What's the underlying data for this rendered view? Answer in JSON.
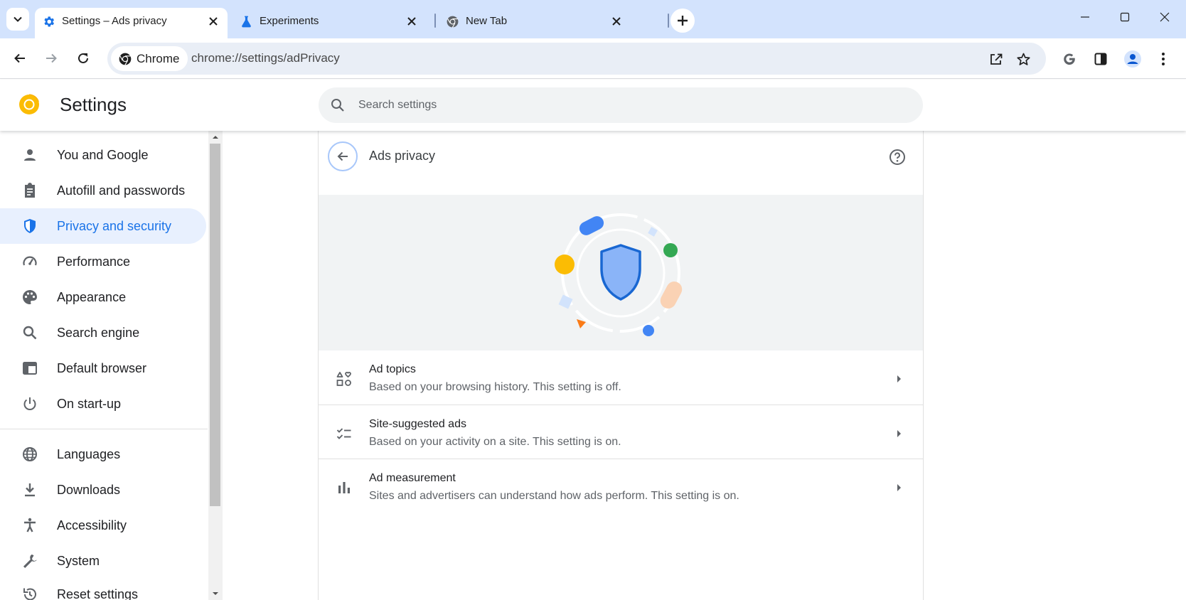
{
  "tabs": [
    {
      "title": "Settings – Ads privacy",
      "active": true
    },
    {
      "title": "Experiments",
      "active": false
    },
    {
      "title": "New Tab",
      "active": false
    }
  ],
  "toolbar": {
    "chip_label": "Chrome",
    "url": "chrome://settings/adPrivacy"
  },
  "header": {
    "title": "Settings",
    "search_placeholder": "Search settings"
  },
  "sidebar": {
    "items": [
      {
        "label": "You and Google",
        "icon": "person-icon"
      },
      {
        "label": "Autofill and passwords",
        "icon": "clipboard-icon"
      },
      {
        "label": "Privacy and security",
        "icon": "shield-icon",
        "selected": true
      },
      {
        "label": "Performance",
        "icon": "speedometer-icon"
      },
      {
        "label": "Appearance",
        "icon": "palette-icon"
      },
      {
        "label": "Search engine",
        "icon": "search-icon"
      },
      {
        "label": "Default browser",
        "icon": "browser-window-icon"
      },
      {
        "label": "On start-up",
        "icon": "power-icon"
      },
      {
        "label": "Languages",
        "icon": "globe-icon"
      },
      {
        "label": "Downloads",
        "icon": "download-icon"
      },
      {
        "label": "Accessibility",
        "icon": "accessibility-icon"
      },
      {
        "label": "System",
        "icon": "wrench-icon"
      },
      {
        "label": "Reset settings",
        "icon": "reset-icon"
      }
    ]
  },
  "page": {
    "title": "Ads privacy",
    "rows": [
      {
        "title": "Ad topics",
        "subtitle": "Based on your browsing history. This setting is off.",
        "icon": "ad-topics-icon"
      },
      {
        "title": "Site-suggested ads",
        "subtitle": "Based on your activity on a site. This setting is on.",
        "icon": "checklist-icon"
      },
      {
        "title": "Ad measurement",
        "subtitle": "Sites and advertisers can understand how ads perform. This setting is on.",
        "icon": "bar-chart-icon"
      }
    ]
  },
  "colors": {
    "accent": "#1a73e8",
    "tabstrip": "#d3e3fd",
    "selected_nav_bg": "#e8f0fe",
    "hero_bg": "#f1f3f4"
  }
}
